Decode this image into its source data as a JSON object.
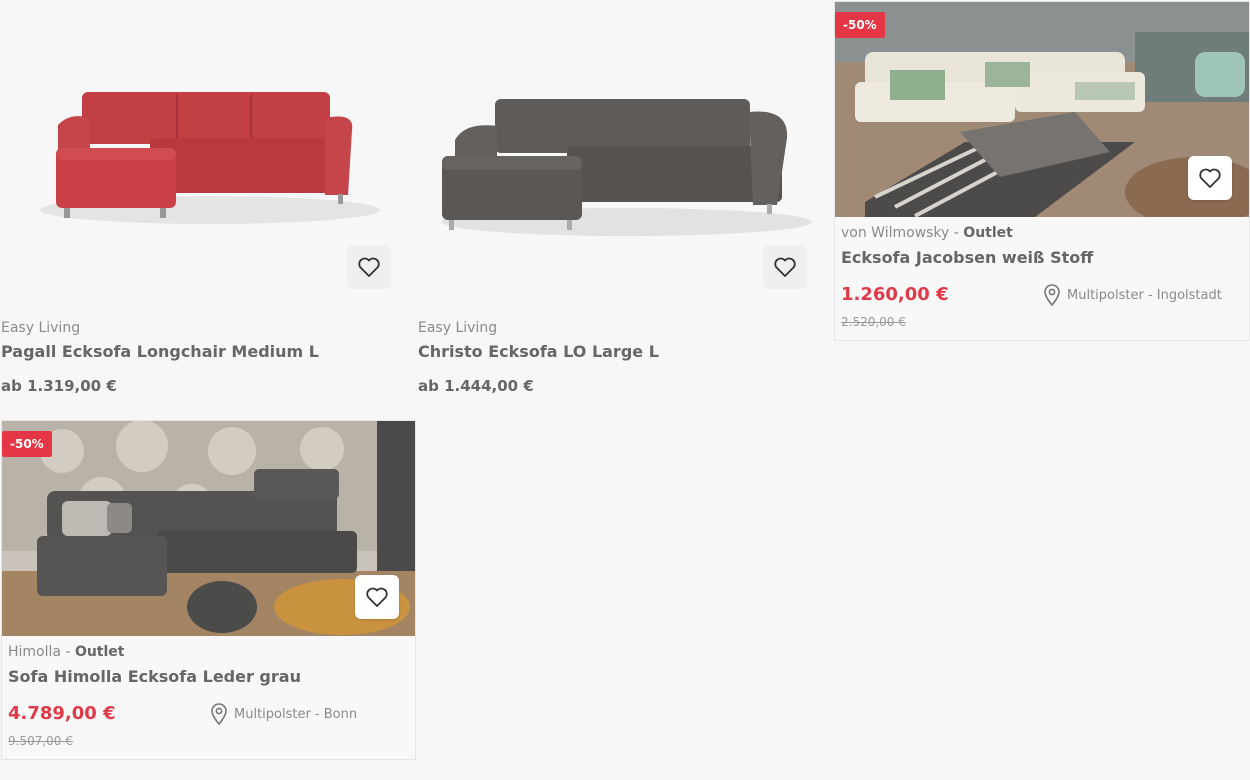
{
  "products": [
    {
      "brand": "Easy Living",
      "title": "Pagall Ecksofa Longchair Medium L",
      "price": "ab 1.319,00 €"
    },
    {
      "brand": "Easy Living",
      "title": "Christo Ecksofa LO Large L",
      "price": "ab 1.444,00 €"
    },
    {
      "badge": "-50%",
      "brand": "von Wilmowsky",
      "brand_sep": " - ",
      "brand_tag": "Outlet",
      "title": "Ecksofa Jacobsen weiß Stoff",
      "price": "1.260,00 €",
      "old_price": "2.520,00 €",
      "location": "Multipolster - Ingolstadt"
    },
    {
      "badge": "-50%",
      "brand": "Himolla",
      "brand_sep": " - ",
      "brand_tag": "Outlet",
      "title": "Sofa Himolla Ecksofa Leder grau",
      "price": "4.789,00 €",
      "old_price": "9.507,00 €",
      "location": "Multipolster - Bonn"
    }
  ],
  "icons": {
    "favorite": "heart-icon",
    "location": "map-pin-icon"
  },
  "colors": {
    "accent_red": "#e0394a",
    "badge_red": "#e53646",
    "background": "#f7f7f7"
  }
}
